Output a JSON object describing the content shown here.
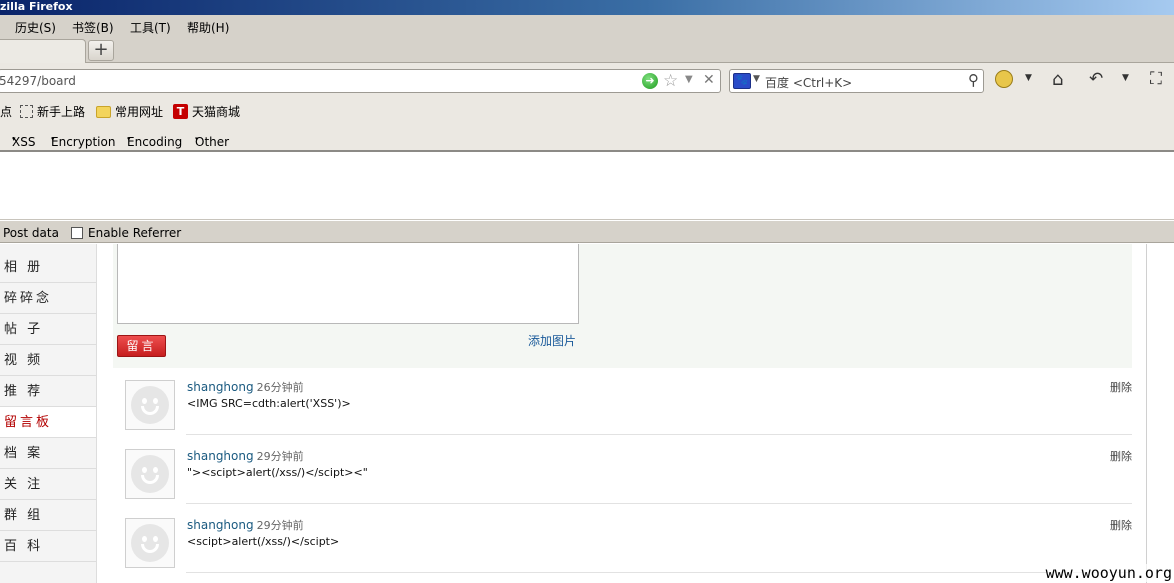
{
  "window": {
    "title": "zilla Firefox"
  },
  "menu": [
    "历史(S)",
    "书签(B)",
    "工具(T)",
    "帮助(H)"
  ],
  "tabs": {
    "new_tab": "+"
  },
  "navbar": {
    "url": "54297/board",
    "search_placeholder": "百度 <Ctrl+K>",
    "icons": [
      "go-icon",
      "star-icon",
      "dropdown-icon",
      "stop-icon",
      "search-engine-icon",
      "magnifier-icon",
      "addon-icon",
      "home-icon",
      "history-back-icon",
      "fullscreen-icon"
    ]
  },
  "bookmarks": [
    "点",
    "新手上路",
    "常用网址",
    "天猫商城"
  ],
  "hackbar": {
    "menus": [
      "XSS",
      "Encryption",
      "Encoding",
      "Other"
    ],
    "post_data": "Post data",
    "enable_referrer": "Enable Referrer"
  },
  "sidebar": {
    "items": [
      "相 册",
      "碎碎念",
      "帖 子",
      "视 频",
      "推 荐",
      "留言板",
      "档 案",
      "关 注",
      "群 组",
      "百 科"
    ],
    "active_index": 5
  },
  "compose": {
    "post_button": "留言",
    "add_image": "添加图片"
  },
  "messages": [
    {
      "author": "shanghong",
      "time": "26分钟前",
      "text": "<IMG SRC=cdth:alert('XSS')>",
      "delete": "删除"
    },
    {
      "author": "shanghong",
      "time": "29分钟前",
      "text": "\"><scipt>alert(/xss/)</scipt><\"",
      "delete": "删除"
    },
    {
      "author": "shanghong",
      "time": "29分钟前",
      "text": "<scipt>alert(/xss/)</scipt>",
      "delete": "删除"
    }
  ],
  "watermark": "www.wooyun.org"
}
